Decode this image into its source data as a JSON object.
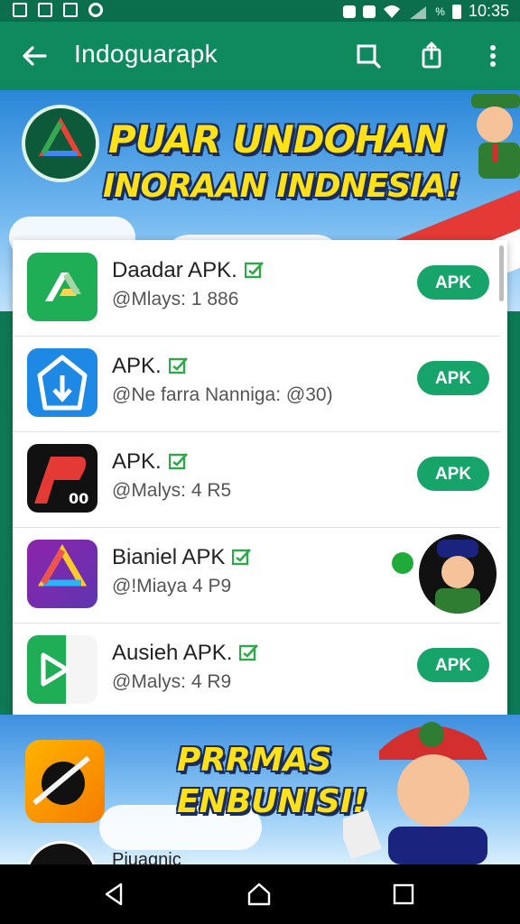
{
  "status_bar": {
    "time": "10:35",
    "battery_percent_symbol": "%"
  },
  "app_bar": {
    "title": "Indoguarapk",
    "icons": [
      "back-arrow-icon",
      "search-icon",
      "share-icon",
      "more-vert-icon"
    ]
  },
  "banner": {
    "title": "PUAR UNDOHAN",
    "subtitle": "INORAAN INDNESIA!"
  },
  "apps": [
    {
      "name": "Daadar APK.",
      "subtitle": "@Mlays: 1 886",
      "button": "APK",
      "icon": "drive-green-icon"
    },
    {
      "name": "APK.",
      "subtitle": "@Ne farra Nanniga: @30)",
      "button": "APK",
      "icon": "blue-shield-icon"
    },
    {
      "name": "APK.",
      "subtitle": "@Malys: 4 R5",
      "button": "APK",
      "icon": "pr-red-icon"
    },
    {
      "name": "Bianiel APK",
      "subtitle": "@!Miaya 4 P9",
      "button": "",
      "icon": "drive-purple-icon"
    },
    {
      "name": "Ausieh APK.",
      "subtitle": "@Malys: 4 R9",
      "button": "APK",
      "icon": "play-green-icon"
    }
  ],
  "promo": {
    "title": "PRRMAS ENBUNISI!",
    "bottom_text": "Piuagnic"
  },
  "colors": {
    "primary": "#0f8a5f",
    "status": "#0b6e4c",
    "button": "#17a46a"
  }
}
